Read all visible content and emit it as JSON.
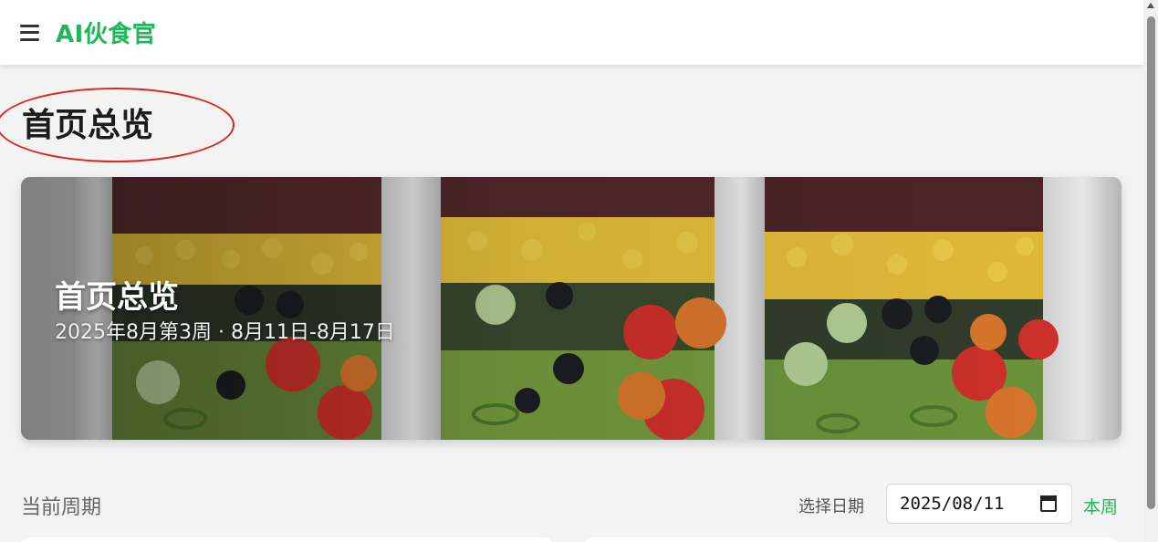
{
  "app": {
    "brand": "AI伙食官"
  },
  "page": {
    "title": "首页总览"
  },
  "hero": {
    "title": "首页总览",
    "subtitle": "2025年8月第3周 · 8月11日-8月17日"
  },
  "period": {
    "label": "当前周期",
    "date_label": "选择日期",
    "date_value": "2025/08/11",
    "this_week": "本周"
  },
  "icons": [
    "menu-icon",
    "calendar-icon"
  ],
  "colors": {
    "brand_green": "#22b65a",
    "annotation_red": "#e0231c"
  }
}
